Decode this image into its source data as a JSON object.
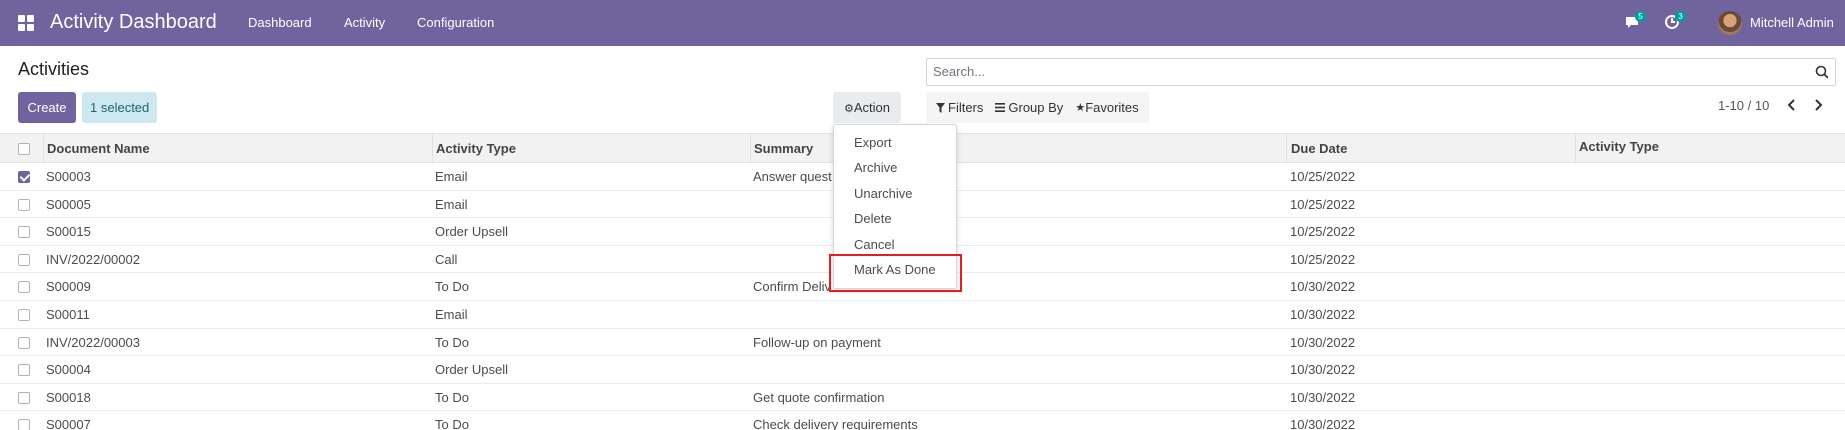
{
  "navbar": {
    "app_title": "Activity Dashboard",
    "menu": [
      "Dashboard",
      "Activity",
      "Configuration"
    ],
    "messages_badge": "5",
    "activities_badge": "3",
    "user_name": "Mitchell Admin",
    "color": "#71639e"
  },
  "control": {
    "title": "Activities",
    "create_label": "Create",
    "selected_label": "1 selected",
    "action_label": "Action",
    "search_placeholder": "Search...",
    "filters_label": "Filters",
    "groupby_label": "Group By",
    "favorites_label": "Favorites",
    "pager": "1-10 / 10"
  },
  "table": {
    "headers": [
      "Document Name",
      "Activity Type",
      "Summary",
      "Due Date",
      "Activity Type"
    ],
    "rows": [
      {
        "doc": "S00003",
        "type": "Email",
        "summary": "Answer quest",
        "due": "10/25/2022",
        "checked": true
      },
      {
        "doc": "S00005",
        "type": "Email",
        "summary": "",
        "due": "10/25/2022",
        "checked": false
      },
      {
        "doc": "S00015",
        "type": "Order Upsell",
        "summary": "",
        "due": "10/25/2022",
        "checked": false
      },
      {
        "doc": "INV/2022/00002",
        "type": "Call",
        "summary": "",
        "due": "10/25/2022",
        "checked": false
      },
      {
        "doc": "S00009",
        "type": "To Do",
        "summary": "Confirm Deliv",
        "due": "10/30/2022",
        "checked": false
      },
      {
        "doc": "S00011",
        "type": "Email",
        "summary": "",
        "due": "10/30/2022",
        "checked": false
      },
      {
        "doc": "INV/2022/00003",
        "type": "To Do",
        "summary": "Follow-up on payment",
        "due": "10/30/2022",
        "checked": false
      },
      {
        "doc": "S00004",
        "type": "Order Upsell",
        "summary": "",
        "due": "10/30/2022",
        "checked": false
      },
      {
        "doc": "S00018",
        "type": "To Do",
        "summary": "Get quote confirmation",
        "due": "10/30/2022",
        "checked": false
      },
      {
        "doc": "S00007",
        "type": "To Do",
        "summary": "Check delivery requirements",
        "due": "10/30/2022",
        "checked": false
      }
    ]
  },
  "action_menu": {
    "items": [
      "Export",
      "Archive",
      "Unarchive",
      "Delete",
      "Cancel",
      "Mark As Done"
    ]
  }
}
